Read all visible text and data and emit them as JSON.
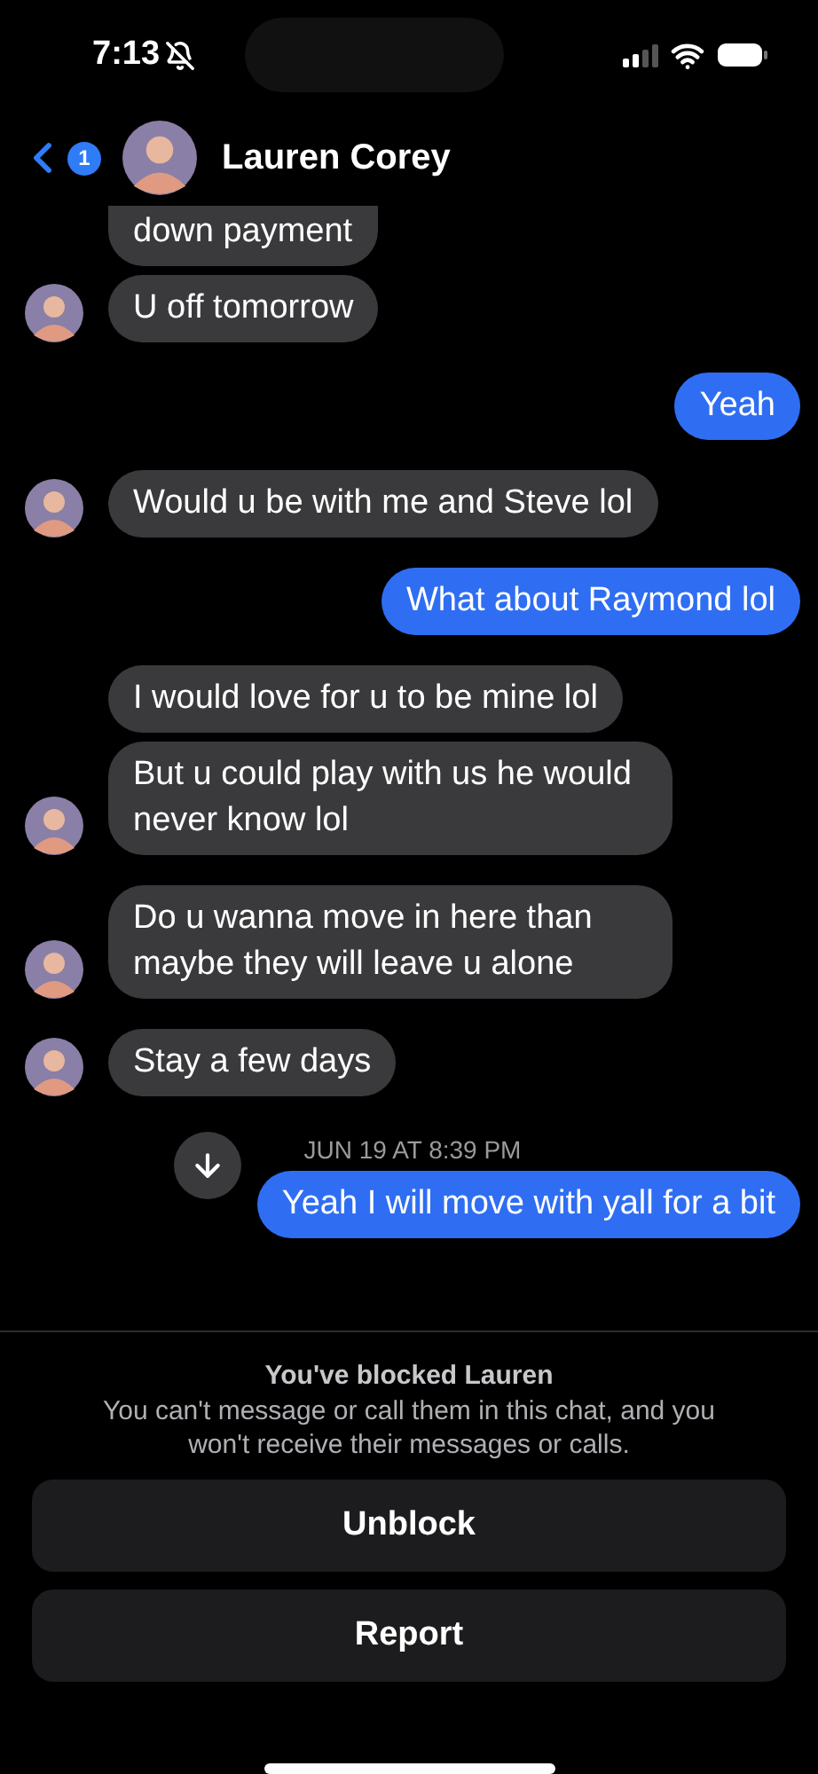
{
  "status_bar": {
    "time": "7:13",
    "muted": true
  },
  "header": {
    "back_badge": "1",
    "name": "Lauren Corey"
  },
  "messages": [
    {
      "kind": "incoming",
      "text": "down payment",
      "avatar": false,
      "clipped": true
    },
    {
      "kind": "incoming",
      "text": "U off tomorrow",
      "avatar": true
    },
    {
      "kind": "outgoing",
      "text": "Yeah"
    },
    {
      "kind": "incoming",
      "text": "Would u be with me and Steve lol",
      "avatar": true
    },
    {
      "kind": "outgoing",
      "text": "What about Raymond lol"
    },
    {
      "kind": "incoming",
      "text": "I would love for u to be mine lol",
      "avatar": false
    },
    {
      "kind": "incoming",
      "text": "But u could play with us he would never know lol",
      "avatar": true
    },
    {
      "kind": "incoming",
      "text": "Do u wanna move in here than maybe they will leave u alone",
      "avatar": true
    },
    {
      "kind": "incoming",
      "text": "Stay a few days",
      "avatar": true
    },
    {
      "kind": "timestamp",
      "text": "JUN 19 AT 8:39 PM"
    },
    {
      "kind": "outgoing",
      "text": "Yeah I will move with yall for a bit"
    }
  ],
  "blocked_notice": {
    "title": "You've blocked Lauren",
    "body": "You can't message or call them in this chat, and you won't receive their messages or calls."
  },
  "buttons": [
    "Unblock",
    "Report"
  ]
}
